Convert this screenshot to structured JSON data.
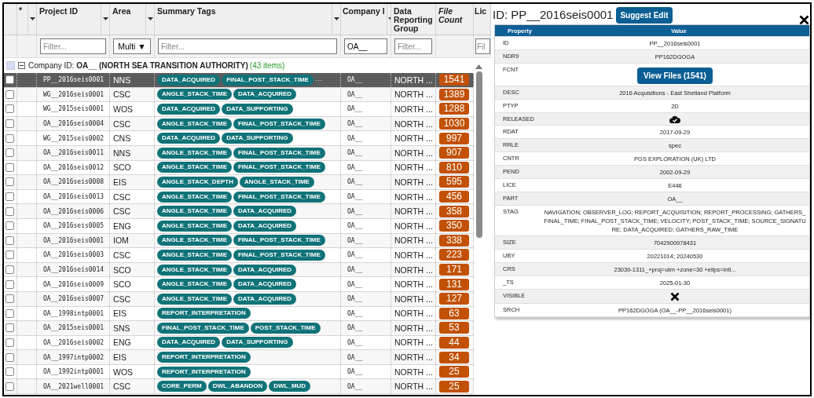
{
  "grid": {
    "columns": [
      {
        "label": "*",
        "menu": true,
        "italic": false
      },
      {
        "label": "Project ID",
        "menu": true,
        "italic": false
      },
      {
        "label": "Area",
        "menu": true,
        "italic": false
      },
      {
        "label": "Summary Tags",
        "menu": true,
        "italic": false
      },
      {
        "label": "Company I",
        "menu": true,
        "italic": false
      },
      {
        "label": "Data Reporting Group",
        "menu": false,
        "italic": false
      },
      {
        "label": "File Count",
        "menu": false,
        "italic": true
      },
      {
        "label": "Lic",
        "menu": false,
        "italic": false
      }
    ],
    "filters": [
      {
        "kind": "none"
      },
      {
        "kind": "none"
      },
      {
        "kind": "text",
        "placeholder": "Filter..."
      },
      {
        "kind": "select",
        "value": "Multi ▼"
      },
      {
        "kind": "text",
        "placeholder": "Filter..."
      },
      {
        "kind": "text",
        "value": "OA__"
      },
      {
        "kind": "text",
        "placeholder": "Filter..."
      },
      {
        "kind": "none"
      },
      {
        "kind": "text",
        "placeholder": "Fil"
      }
    ],
    "group": {
      "checked": false,
      "expanded": true,
      "label": "Company ID: ",
      "value": "OA__ (NORTH SEA TRANSITION AUTHORITY)",
      "count": "(43 items)"
    },
    "rows": [
      {
        "checked": false,
        "selected": true,
        "project_id": "PP__2016seis0001",
        "area": "NNS",
        "tags": [
          "DATA_ACQUIRED",
          "FINAL_POST_STACK_TIME"
        ],
        "more": "···",
        "company": "OA__",
        "group": "NORTH ...",
        "file_count": "1541"
      },
      {
        "checked": false,
        "selected": false,
        "project_id": "WG__2016seis0001",
        "area": "CSC",
        "tags": [
          "ANGLE_STACK_TIME",
          "DATA_ACQUIRED"
        ],
        "company": "OA__",
        "group": "NORTH ...",
        "file_count": "1389"
      },
      {
        "checked": false,
        "selected": false,
        "project_id": "WG__2015seis0001",
        "area": "WOS",
        "tags": [
          "DATA_ACQUIRED",
          "DATA_SUPPORTING"
        ],
        "company": "OA__",
        "group": "NORTH ...",
        "file_count": "1288"
      },
      {
        "checked": false,
        "selected": false,
        "project_id": "OA__2016seis0004",
        "area": "CSC",
        "tags": [
          "ANGLE_STACK_TIME",
          "FINAL_POST_STACK_TIME"
        ],
        "company": "OA__",
        "group": "NORTH ...",
        "file_count": "1030"
      },
      {
        "checked": false,
        "selected": false,
        "project_id": "WG__2015seis0002",
        "area": "CNS",
        "tags": [
          "DATA_ACQUIRED",
          "DATA_SUPPORTING"
        ],
        "company": "OA__",
        "group": "NORTH ...",
        "file_count": "997"
      },
      {
        "checked": false,
        "selected": false,
        "project_id": "OA__2016seis0011",
        "area": "NNS",
        "tags": [
          "ANGLE_STACK_TIME",
          "FINAL_POST_STACK_TIME"
        ],
        "company": "OA__",
        "group": "NORTH ...",
        "file_count": "907"
      },
      {
        "checked": false,
        "selected": false,
        "project_id": "OA__2016seis0012",
        "area": "SCO",
        "tags": [
          "ANGLE_STACK_TIME",
          "FINAL_POST_STACK_TIME"
        ],
        "company": "OA__",
        "group": "NORTH ...",
        "file_count": "810"
      },
      {
        "checked": false,
        "selected": false,
        "project_id": "OA__2016seis0008",
        "area": "EIS",
        "tags": [
          "ANGLE_STACK_DEPTH",
          "ANGLE_STACK_TIME"
        ],
        "company": "OA__",
        "group": "NORTH ...",
        "file_count": "595"
      },
      {
        "checked": false,
        "selected": false,
        "project_id": "OA__2016seis0013",
        "area": "CSC",
        "tags": [
          "ANGLE_STACK_TIME",
          "FINAL_POST_STACK_TIME"
        ],
        "company": "OA__",
        "group": "NORTH ...",
        "file_count": "456"
      },
      {
        "checked": false,
        "selected": false,
        "project_id": "OA__2016seis0006",
        "area": "CSC",
        "tags": [
          "ANGLE_STACK_TIME",
          "DATA_ACQUIRED"
        ],
        "company": "OA__",
        "group": "NORTH ...",
        "file_count": "358"
      },
      {
        "checked": false,
        "selected": false,
        "project_id": "OA__2016seis0005",
        "area": "ENG",
        "tags": [
          "ANGLE_STACK_TIME",
          "DATA_ACQUIRED"
        ],
        "company": "OA__",
        "group": "NORTH ...",
        "file_count": "350"
      },
      {
        "checked": false,
        "selected": false,
        "project_id": "OA__2016seis0001",
        "area": "IOM",
        "tags": [
          "ANGLE_STACK_TIME",
          "FINAL_POST_STACK_TIME"
        ],
        "company": "OA__",
        "group": "NORTH ...",
        "file_count": "338"
      },
      {
        "checked": false,
        "selected": false,
        "project_id": "OA__2016seis0003",
        "area": "CSC",
        "tags": [
          "ANGLE_STACK_TIME",
          "FINAL_POST_STACK_TIME"
        ],
        "company": "OA__",
        "group": "NORTH ...",
        "file_count": "223"
      },
      {
        "checked": false,
        "selected": false,
        "project_id": "OA__2016seis0014",
        "area": "SCO",
        "tags": [
          "ANGLE_STACK_TIME",
          "DATA_ACQUIRED"
        ],
        "company": "OA__",
        "group": "NORTH ...",
        "file_count": "171"
      },
      {
        "checked": false,
        "selected": false,
        "project_id": "OA__2016seis0009",
        "area": "SCO",
        "tags": [
          "ANGLE_STACK_TIME",
          "DATA_ACQUIRED"
        ],
        "company": "OA__",
        "group": "NORTH ...",
        "file_count": "131"
      },
      {
        "checked": false,
        "selected": false,
        "project_id": "OA__2016seis0007",
        "area": "CSC",
        "tags": [
          "ANGLE_STACK_TIME",
          "DATA_ACQUIRED"
        ],
        "company": "OA__",
        "group": "NORTH ...",
        "file_count": "127"
      },
      {
        "checked": false,
        "selected": false,
        "project_id": "OA__1998intp0001",
        "area": "EIS",
        "tags": [
          "REPORT_INTERPRETATION"
        ],
        "company": "OA__",
        "group": "NORTH ...",
        "file_count": "63"
      },
      {
        "checked": false,
        "selected": false,
        "project_id": "OA__2015seis0001",
        "area": "SNS",
        "tags": [
          "FINAL_POST_STACK_TIME",
          "POST_STACK_TIME"
        ],
        "company": "OA__",
        "group": "NORTH ...",
        "file_count": "53"
      },
      {
        "checked": false,
        "selected": false,
        "project_id": "OA__2016seis0002",
        "area": "ENG",
        "tags": [
          "DATA_ACQUIRED",
          "DATA_SUPPORTING"
        ],
        "company": "OA__",
        "group": "NORTH ...",
        "file_count": "44"
      },
      {
        "checked": false,
        "selected": false,
        "project_id": "OA__1997intp0002",
        "area": "EIS",
        "tags": [
          "REPORT_INTERPRETATION"
        ],
        "company": "OA__",
        "group": "NORTH ...",
        "file_count": "34"
      },
      {
        "checked": false,
        "selected": false,
        "project_id": "OA__1992intp0001",
        "area": "WOS",
        "tags": [
          "REPORT_INTERPRETATION"
        ],
        "company": "OA__",
        "group": "NORTH ...",
        "file_count": "25"
      },
      {
        "checked": false,
        "selected": false,
        "project_id": "OA__2021well0001",
        "area": "CSC",
        "tags": [
          "CORE_PERM",
          "DWL_ABANDON",
          "DWL_MUD"
        ],
        "company": "OA__",
        "group": "NORTH ...",
        "file_count": "25"
      }
    ]
  },
  "panel": {
    "title": "ID: PP__2016seis0001",
    "suggest_button": "Suggest Edit",
    "columns": [
      "Property",
      "Value"
    ],
    "rows": [
      {
        "kind": "text",
        "property": "ID",
        "value": "PP__2016seis0001"
      },
      {
        "kind": "text",
        "property": "NDR9",
        "value": "PP162DGOGA"
      },
      {
        "kind": "button",
        "property": "FCNT",
        "value": "View Files (1541)"
      },
      {
        "kind": "text",
        "property": "DESC",
        "value": "2016 Acquisitions - East Shetland Platform"
      },
      {
        "kind": "text",
        "property": "PTYP",
        "value": "2D"
      },
      {
        "kind": "flag",
        "property": "RELEASED",
        "on": true
      },
      {
        "kind": "text",
        "property": "RDAT",
        "value": "2017-09-29"
      },
      {
        "kind": "text",
        "property": "RRLE",
        "value": "spec"
      },
      {
        "kind": "text",
        "property": "CNTR",
        "value": "PGS EXPLORATION (UK) LTD"
      },
      {
        "kind": "text",
        "property": "PEND",
        "value": "2002-09-29"
      },
      {
        "kind": "text",
        "property": "LICE",
        "value": "E446"
      },
      {
        "kind": "text",
        "property": "PART",
        "value": "OA__"
      },
      {
        "kind": "text",
        "property": "STAG",
        "value": "NAVIGATION; OBSERVER_LOG; REPORT_ACQUISITION; REPORT_PROCESSING; GATHERS_FINAL_TIME; FINAL_POST_STACK_TIME; VELOCITY; POST_STACK_TIME; SOURCE_SIGNATURE; DATA_ACQUIRED; GATHERS_RAW_TIME"
      },
      {
        "kind": "text",
        "property": "SIZE",
        "value": "7042900978431"
      },
      {
        "kind": "text",
        "property": "UBY",
        "value": "20221014; 20240530"
      },
      {
        "kind": "text",
        "property": "CRS",
        "value": "23030-1311_+proj=utm +zone=30 +ellps=intl..."
      },
      {
        "kind": "text",
        "property": "_TS",
        "value": "2025-01-30"
      },
      {
        "kind": "flag",
        "property": "VISIBLE",
        "on": false
      },
      {
        "kind": "text",
        "property": "SRCH",
        "value": "PP162DGOGA (OA__-PP__2016seis0001)"
      }
    ]
  }
}
